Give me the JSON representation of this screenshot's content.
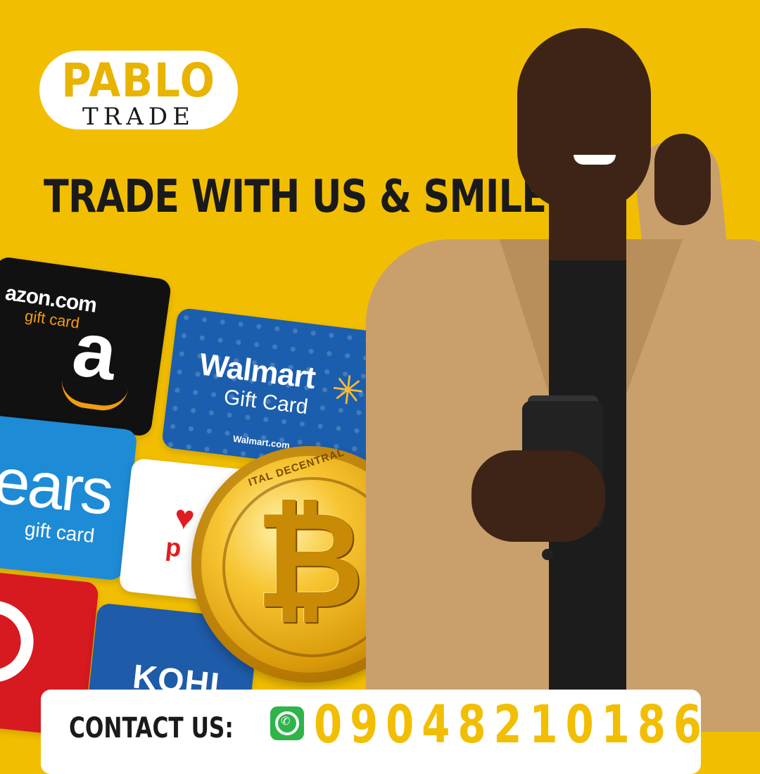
{
  "brand": {
    "name_top": "PABLO",
    "name_bottom": "TRADE"
  },
  "headline": "TRADE WITH US & SMILE",
  "gift_cards": {
    "amazon": {
      "line1": "azon.com",
      "line2": "gift card",
      "glyph": "a"
    },
    "walmart": {
      "line1": "Walmart",
      "line2": "Gift Card",
      "url": "Walmart.com"
    },
    "sears": {
      "line1": "ears",
      "line2": "gift card"
    },
    "jcpenney": {
      "glyph": "p"
    },
    "kohls": {
      "line1": "KOHL"
    }
  },
  "coin": {
    "rim_text": "ITAL DECENTRAL",
    "symbol": "₿"
  },
  "contact": {
    "label": "CONTACT US:",
    "phone": "09048210186",
    "icon": "whatsapp-icon"
  },
  "colors": {
    "background": "#F2BE02",
    "accent": "#F2BE02",
    "whatsapp": "#2FB44A"
  }
}
